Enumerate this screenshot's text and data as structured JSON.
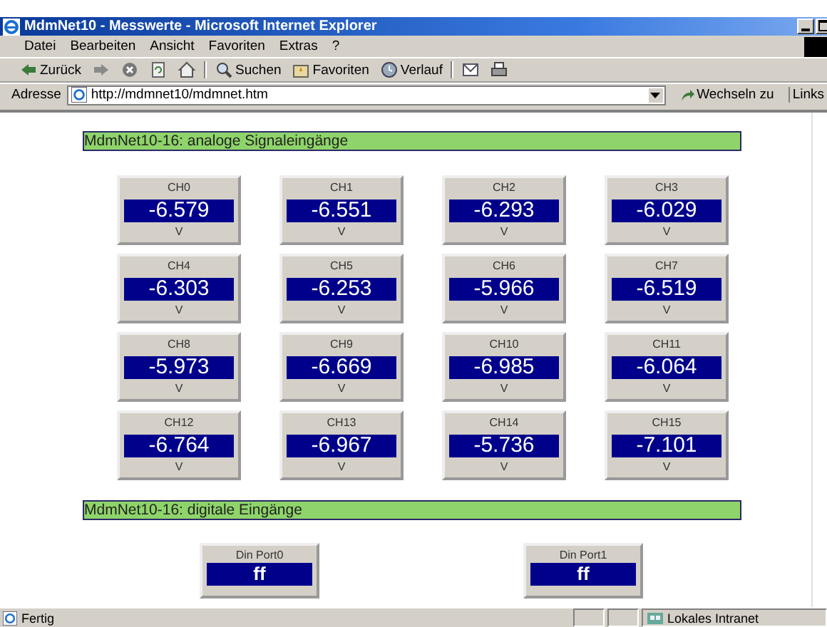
{
  "window": {
    "title": "MdmNet10 - Messwerte - Microsoft Internet Explorer"
  },
  "menu": [
    "Datei",
    "Bearbeiten",
    "Ansicht",
    "Favoriten",
    "Extras",
    "?"
  ],
  "toolbar": [
    {
      "kind": "back",
      "label": "Zurück"
    },
    {
      "kind": "forward"
    },
    {
      "kind": "stop"
    },
    {
      "kind": "refresh"
    },
    {
      "kind": "home"
    },
    {
      "kind": "search",
      "label": "Suchen"
    },
    {
      "kind": "favorites",
      "label": "Favoriten"
    },
    {
      "kind": "history",
      "label": "Verlauf"
    },
    {
      "kind": "mail"
    },
    {
      "kind": "print"
    }
  ],
  "address": {
    "label": "Adresse",
    "url": "http://mdmnet10/mdmnet.htm",
    "go": "Wechseln zu",
    "links": "Links"
  },
  "sections": [
    {
      "kind": "analog",
      "title": "MdmNet10-16: analoge Signaleingänge",
      "channels": [
        {
          "name": "CH0",
          "value": "-6.579",
          "unit": "V"
        },
        {
          "name": "CH1",
          "value": "-6.551",
          "unit": "V"
        },
        {
          "name": "CH2",
          "value": "-6.293",
          "unit": "V"
        },
        {
          "name": "CH3",
          "value": "-6.029",
          "unit": "V"
        },
        {
          "name": "CH4",
          "value": "-6.303",
          "unit": "V"
        },
        {
          "name": "CH5",
          "value": "-6.253",
          "unit": "V"
        },
        {
          "name": "CH6",
          "value": "-5.966",
          "unit": "V"
        },
        {
          "name": "CH7",
          "value": "-6.519",
          "unit": "V"
        },
        {
          "name": "CH8",
          "value": "-5.973",
          "unit": "V"
        },
        {
          "name": "CH9",
          "value": "-6.669",
          "unit": "V"
        },
        {
          "name": "CH10",
          "value": "-6.985",
          "unit": "V"
        },
        {
          "name": "CH11",
          "value": "-6.064",
          "unit": "V"
        },
        {
          "name": "CH12",
          "value": "-6.764",
          "unit": "V"
        },
        {
          "name": "CH13",
          "value": "-6.967",
          "unit": "V"
        },
        {
          "name": "CH14",
          "value": "-5.736",
          "unit": "V"
        },
        {
          "name": "CH15",
          "value": "-7.101",
          "unit": "V"
        }
      ]
    },
    {
      "kind": "digital",
      "title": "MdmNet10-16: digitale Eingänge",
      "ports": [
        {
          "name": "Din Port0",
          "value": "ff"
        },
        {
          "name": "Din Port1",
          "value": "ff"
        }
      ]
    }
  ],
  "status_bar": {
    "text": "Fertig",
    "zone": "Lokales Intranet"
  }
}
